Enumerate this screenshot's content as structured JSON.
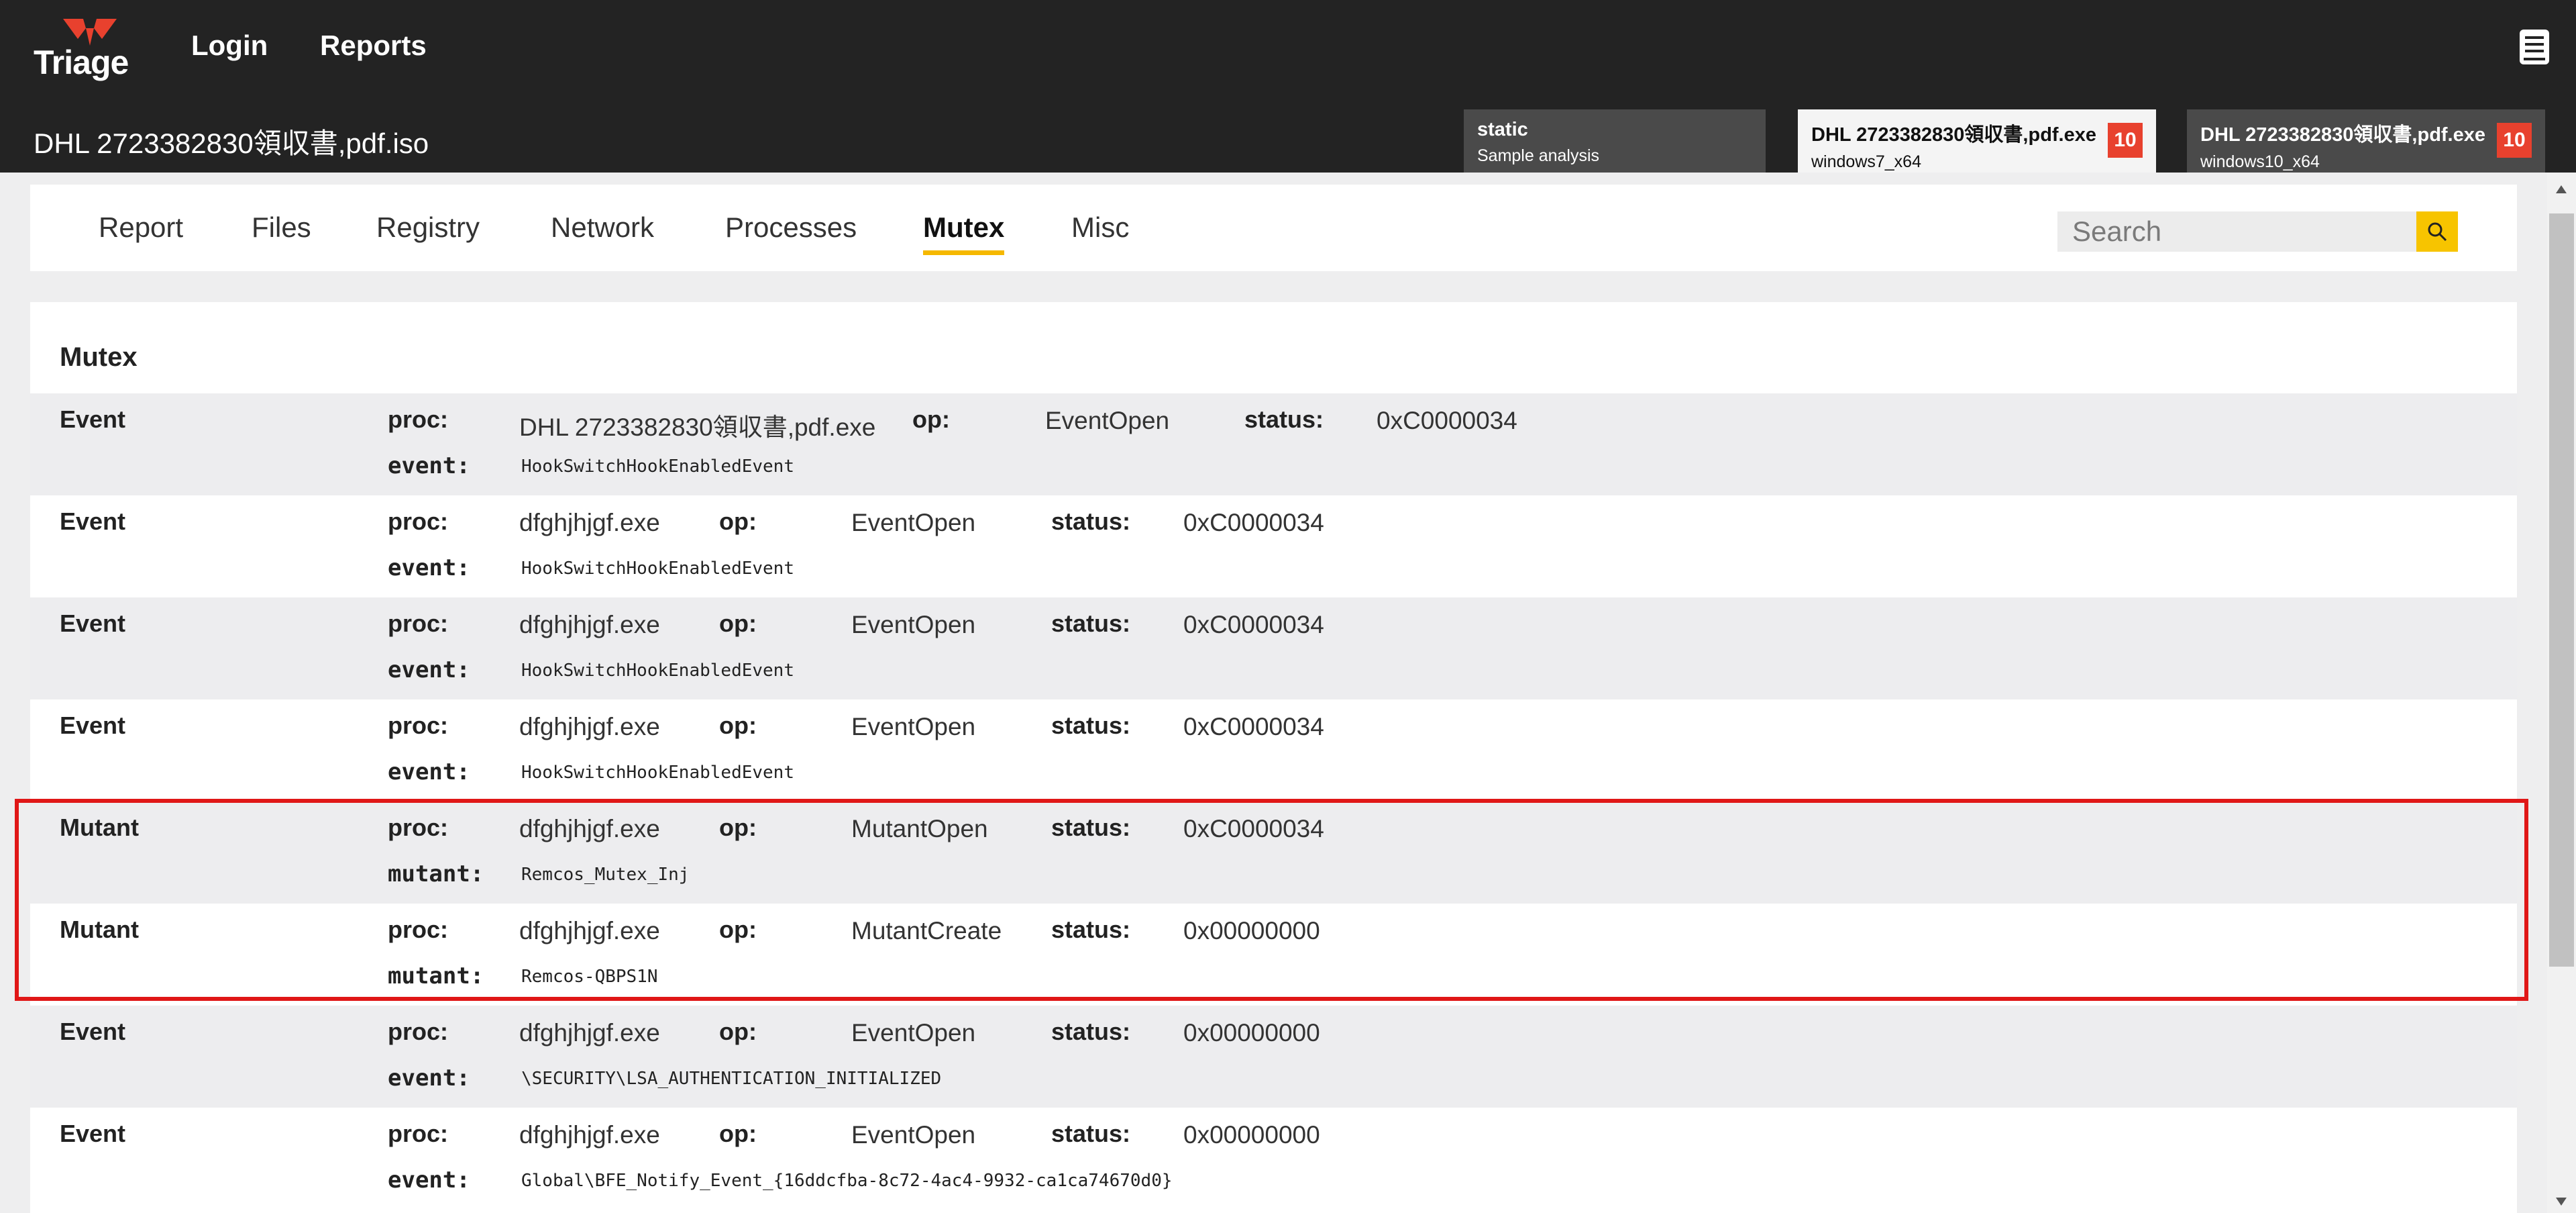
{
  "header": {
    "logo_text": "Triage",
    "nav": {
      "login": "Login",
      "reports": "Reports"
    },
    "sample_title": "DHL 2723382830領収書,pdf.iso",
    "analysis_tabs": [
      {
        "title": "static",
        "subtitle": "Sample analysis",
        "score": ""
      },
      {
        "title": "DHL 2723382830領収書,pdf.exe",
        "subtitle": "windows7_x64",
        "score": "10"
      },
      {
        "title": "DHL 2723382830領収書,pdf.exe",
        "subtitle": "windows10_x64",
        "score": "10"
      }
    ]
  },
  "tabs": [
    "Report",
    "Files",
    "Registry",
    "Network",
    "Processes",
    "Mutex",
    "Misc"
  ],
  "active_tab": "Mutex",
  "search": {
    "placeholder": "Search"
  },
  "labels": {
    "proc": "proc:",
    "op": "op:",
    "status": "status:"
  },
  "panel": {
    "title": "Mutex",
    "rows": [
      {
        "type": "Event",
        "proc": "DHL 2723382830領収書,pdf.exe",
        "op": "EventOpen",
        "status": "0xC0000034",
        "key": "event:",
        "value": "HookSwitchHookEnabledEvent"
      },
      {
        "type": "Event",
        "proc": "dfghjhjgf.exe",
        "op": "EventOpen",
        "status": "0xC0000034",
        "key": "event:",
        "value": "HookSwitchHookEnabledEvent"
      },
      {
        "type": "Event",
        "proc": "dfghjhjgf.exe",
        "op": "EventOpen",
        "status": "0xC0000034",
        "key": "event:",
        "value": "HookSwitchHookEnabledEvent"
      },
      {
        "type": "Event",
        "proc": "dfghjhjgf.exe",
        "op": "EventOpen",
        "status": "0xC0000034",
        "key": "event:",
        "value": "HookSwitchHookEnabledEvent"
      },
      {
        "type": "Mutant",
        "proc": "dfghjhjgf.exe",
        "op": "MutantOpen",
        "status": "0xC0000034",
        "key": "mutant:",
        "value": "Remcos_Mutex_Inj"
      },
      {
        "type": "Mutant",
        "proc": "dfghjhjgf.exe",
        "op": "MutantCreate",
        "status": "0x00000000",
        "key": "mutant:",
        "value": "Remcos-QBPS1N"
      },
      {
        "type": "Event",
        "proc": "dfghjhjgf.exe",
        "op": "EventOpen",
        "status": "0x00000000",
        "key": "event:",
        "value": "\\SECURITY\\LSA_AUTHENTICATION_INITIALIZED"
      },
      {
        "type": "Event",
        "proc": "dfghjhjgf.exe",
        "op": "EventOpen",
        "status": "0x00000000",
        "key": "event:",
        "value": "Global\\BFE_Notify_Event_{16ddcfba-8c72-4ac4-9932-ca1ca74670d0}"
      }
    ]
  },
  "colors": {
    "accent": "#f7c400",
    "score": "#e8412e",
    "highlight": "#e01717",
    "header_bg": "#232323"
  }
}
